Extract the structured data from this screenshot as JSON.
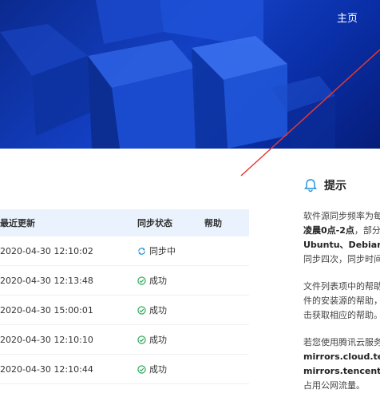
{
  "nav": {
    "home": "主页"
  },
  "table": {
    "headers": {
      "updated": "最近更新",
      "status": "同步状态",
      "help": "帮助"
    },
    "rows": [
      {
        "updated": "2020-04-30 12:10:02",
        "status": "同步中",
        "kind": "syncing"
      },
      {
        "updated": "2020-04-30 12:13:48",
        "status": "成功",
        "kind": "success"
      },
      {
        "updated": "2020-04-30 15:00:01",
        "status": "成功",
        "kind": "success"
      },
      {
        "updated": "2020-04-30 12:10:10",
        "status": "成功",
        "kind": "success"
      },
      {
        "updated": "2020-04-30 12:10:44",
        "status": "成功",
        "kind": "success"
      }
    ]
  },
  "tips": {
    "title": "提示",
    "p1_line1": "软件源同步频率为每",
    "p1_line2_bold": "凌晨0点-2点",
    "p1_line2_rest": "，部分",
    "p1_line3_bold": "Ubuntu、Debian、",
    "p1_line4": "同步四次，同步时间",
    "p2_line1": "文件列表项中的帮助",
    "p2_line2": "件的安装源的帮助，",
    "p2_line3": "击获取相应的帮助。",
    "p3_line1": "若您使用腾讯云服务",
    "p3_line2_bold": "mirrors.cloud.tenc",
    "p3_line3_bold": "mirrors.tencentyun",
    "p3_line4": "占用公网流量。"
  },
  "colors": {
    "accent": "#1340c4",
    "success": "#1aa34a",
    "syncing": "#1a8fd6",
    "arrow": "#e53935"
  }
}
